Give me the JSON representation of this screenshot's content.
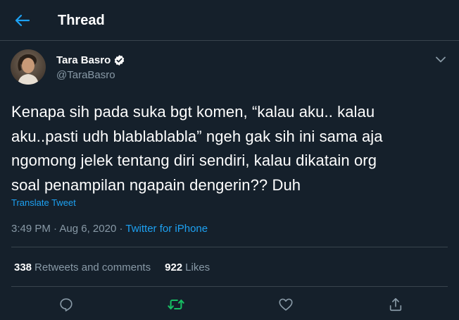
{
  "header": {
    "back_icon": "arrow-left-icon",
    "title": "Thread"
  },
  "tweet": {
    "author": {
      "name": "Tara Basro",
      "handle": "@TaraBasro",
      "verified": true,
      "avatar_icon": "avatar"
    },
    "text": "Kenapa sih pada suka bgt komen, “kalau aku.. kalau\naku..pasti udh blablablabla” ngeh gak sih ini sama aja\nngomong jelek tentang diri sendiri, kalau dikatain org\nsoal penampilan ngapain dengerin?? Duh",
    "translate_label": "Translate Tweet",
    "time": "3:49 PM",
    "date": "Aug 6, 2020",
    "source": "Twitter for iPhone",
    "retweets_count": "338",
    "retweets_label": "Retweets and comments",
    "likes_count": "922",
    "likes_label": "Likes"
  },
  "actions": {
    "reply_icon": "reply-icon",
    "retweet_icon": "retweet-icon",
    "like_icon": "heart-icon",
    "share_icon": "share-icon"
  },
  "colors": {
    "background": "#15202b",
    "accent": "#1da1f2",
    "secondary_text": "#8899a6",
    "divider": "#38444d",
    "retweet_active": "#17bf63"
  }
}
